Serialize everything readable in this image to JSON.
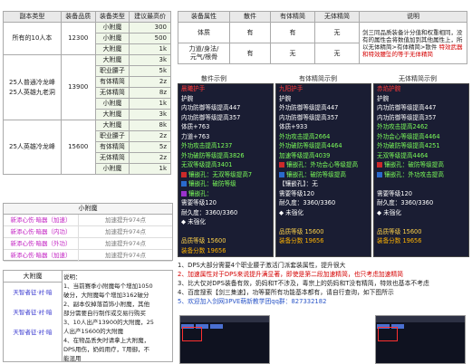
{
  "main_table": {
    "headers": [
      "副本类型",
      "装备品质",
      "装备类型",
      "建议最高价"
    ],
    "groups": [
      {
        "name": "所有的10人本",
        "quality": "12300",
        "rows": [
          {
            "type": "小附魔",
            "price": "300"
          },
          {
            "type": "小附魔",
            "price": "500"
          },
          {
            "type": "大附魔",
            "price": "1k"
          }
        ]
      },
      {
        "name": "25人普通冷龙峰\n25人英雄九老洞",
        "quality": "13900",
        "rows": [
          {
            "type": "大附魔",
            "price": "3k"
          },
          {
            "type": "职业腰子",
            "price": "5k"
          },
          {
            "type": "有体精简",
            "price": "2z"
          },
          {
            "type": "无体精简",
            "price": "8z"
          },
          {
            "type": "小附魔",
            "price": "1k"
          },
          {
            "type": "大附魔",
            "price": "3k"
          }
        ]
      },
      {
        "name": "25人英雄冷龙峰",
        "quality": "15600",
        "rows": [
          {
            "type": "大附魔",
            "price": "8k"
          },
          {
            "type": "职业腰子",
            "price": "2z"
          },
          {
            "type": "有体精简",
            "price": "5z"
          },
          {
            "type": "无体精简",
            "price": "2z"
          },
          {
            "type": "小附魔",
            "price": "1k"
          }
        ]
      }
    ]
  },
  "attr_table": {
    "headers": [
      "装备属性",
      "散件",
      "有体精简",
      "无体精简",
      "说明"
    ],
    "rows": [
      {
        "attr": "体质",
        "a": "有",
        "b": "有",
        "c": "无"
      },
      {
        "attr": "力道/身法/\n元气/根骨",
        "a": "有",
        "b": "无",
        "c": "无"
      }
    ],
    "desc_normal": "剑三同品质装备计分值和权重相同，没有的属性会将数值加到其他属性上，所以无体精简>有体精简>散件",
    "desc_red": "特效武器和特效腰坠的等于无体精简"
  },
  "panels": {
    "titles": [
      "散件示例",
      "有体精简示例",
      "无体精简示例"
    ],
    "list": [
      {
        "lines": [
          {
            "t": "晨曦护手",
            "c": "hd"
          },
          {
            "t": "护腕",
            "c": ""
          },
          {
            "t": "内功防御等级提高447",
            "c": ""
          },
          {
            "t": "内功防御等级提高357",
            "c": ""
          },
          {
            "t": "体质+763",
            "c": ""
          },
          {
            "t": "力道+763",
            "c": ""
          },
          {
            "t": "外功攻击提高1237",
            "c": "g"
          },
          {
            "t": "外功破防等级提高3826",
            "c": "g"
          },
          {
            "t": "无双等级提高3401",
            "c": "g"
          },
          {
            "t": "镶嵌孔：无双等级提高7",
            "c": "gem"
          },
          {
            "t": "镶嵌孔：破防等级",
            "c": "gemb"
          },
          {
            "t": "镶嵌孔：",
            "c": "gemp"
          },
          {
            "t": "需要等级120",
            "c": ""
          },
          {
            "t": "耐久度：3360/3360",
            "c": ""
          },
          {
            "t": "◆ 未强化",
            "c": ""
          },
          {
            "t": "",
            "c": ""
          },
          {
            "t": "品质等级 15600",
            "c": "y"
          },
          {
            "t": "装备分数 19656",
            "c": "gold"
          }
        ]
      },
      {
        "lines": [
          {
            "t": "九阳护手",
            "c": "hd"
          },
          {
            "t": "护腕",
            "c": ""
          },
          {
            "t": "外功防御等级提高447",
            "c": ""
          },
          {
            "t": "内功防御等级提高357",
            "c": ""
          },
          {
            "t": "体质+933",
            "c": ""
          },
          {
            "t": "外功攻击提高2664",
            "c": "g"
          },
          {
            "t": "外功破防等级提高4464",
            "c": "g"
          },
          {
            "t": "加速等级提高4039",
            "c": "g"
          },
          {
            "t": "镶嵌孔：外功会心等级提高",
            "c": "gem"
          },
          {
            "t": "镶嵌孔：破防等级提高",
            "c": "gemb"
          },
          {
            "t": "【镶嵌孔】：无",
            "c": ""
          },
          {
            "t": "需要等级120",
            "c": ""
          },
          {
            "t": "耐久度：3360/3360",
            "c": ""
          },
          {
            "t": "◆ 未强化",
            "c": ""
          },
          {
            "t": "",
            "c": ""
          },
          {
            "t": "品质等级 15600",
            "c": "y"
          },
          {
            "t": "装备分数 19656",
            "c": "gold"
          }
        ]
      },
      {
        "lines": [
          {
            "t": "赤焰护腕",
            "c": "hd"
          },
          {
            "t": "护腕",
            "c": ""
          },
          {
            "t": "内功防御等级提高447",
            "c": ""
          },
          {
            "t": "内功防御等级提高357",
            "c": ""
          },
          {
            "t": "外功攻击提高2462",
            "c": "g"
          },
          {
            "t": "外功会心等级提高4464",
            "c": "g"
          },
          {
            "t": "外功破防等级提高4251",
            "c": "g"
          },
          {
            "t": "无双等级提高4464",
            "c": "g"
          },
          {
            "t": "镶嵌孔：破防等级提高",
            "c": "gem"
          },
          {
            "t": "镶嵌孔：外功攻击提高",
            "c": "gemb"
          },
          {
            "t": "",
            "c": ""
          },
          {
            "t": "需要等级120",
            "c": ""
          },
          {
            "t": "耐久度：3360/3360",
            "c": ""
          },
          {
            "t": "◆ 未强化",
            "c": ""
          },
          {
            "t": "",
            "c": ""
          },
          {
            "t": "品质等级 15600",
            "c": "y"
          },
          {
            "t": "装备分数 19656",
            "c": "gold"
          }
        ]
      }
    ]
  },
  "notes": [
    {
      "t": "1、DPS大部分需要4个职业腰子激活门派套装属性，提升很大",
      "c": ""
    },
    {
      "t": "2、加速属性对于DPS来说提升满显著，即使是第二段加速精简，也只考虑加速精简",
      "c": "red"
    },
    {
      "t": "3、比大仅对DPS装备有效，奶妈和T不涉及，毒宗上的奶妈和T没有精简，特效也基本不考虑",
      "c": ""
    },
    {
      "t": "4、百度搜索【剑三集速】，功等要所有功能基本都有，请自行查询，如下图所示",
      "c": ""
    },
    {
      "t": "5、欢迎加入剑网3PVE萌新教学团qq群：827332182",
      "c": "blue"
    }
  ],
  "xfm": {
    "title": "小附魔",
    "rows": [
      {
        "name": "新添心伤·暗器（加速）",
        "val": "加速提升974点"
      },
      {
        "name": "新添心伤·暗器（内功）",
        "val": "加速提升974点"
      },
      {
        "name": "新添心伤·暗器（外功）",
        "val": "加速提升974点"
      },
      {
        "name": "新添心伤·暗器（加速）",
        "val": "加速提升974点"
      }
    ]
  },
  "dfm": {
    "title": "大附魔",
    "items": [
      "天智者征·衬·暗",
      "天智者征·衬·暗",
      "天智者征·衬·暗"
    ],
    "desc_title": "说明：",
    "desc": [
      "1、当前赛季小附魔每个增加1050",
      "破分，大附魔每个增加3162破分",
      "2、副本仅掉落首饰小附魔，其他",
      "部分需要自行制作或交易行购买",
      "3、10人出产13900的大附魔，25",
      "人出产15600的大附魔",
      "4、在物品丢失时请拿上大附魔，",
      "DPS用伤，奶妈用疗，T用御，不",
      "能混用"
    ]
  }
}
